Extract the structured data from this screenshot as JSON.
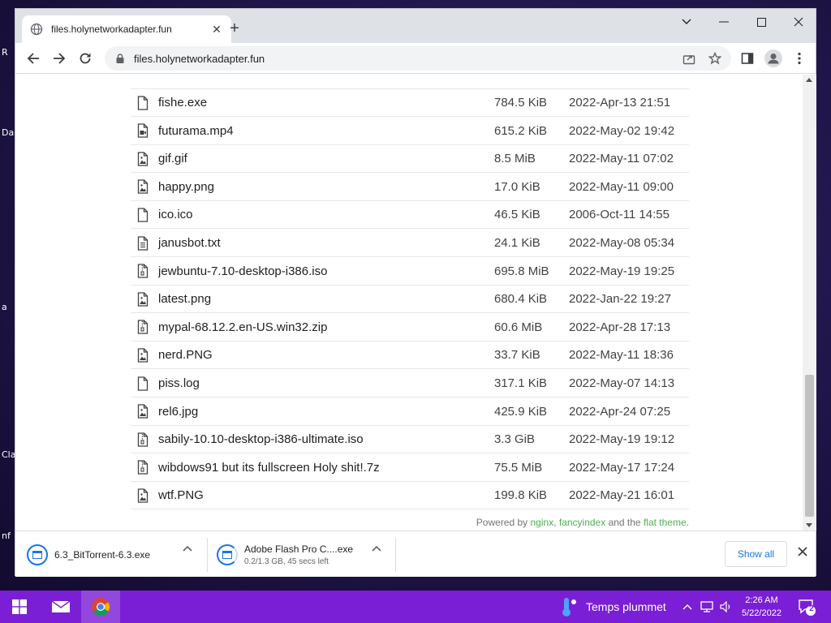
{
  "browser": {
    "tab_title": "files.holynetworkadapter.fun",
    "url": "files.holynetworkadapter.fun"
  },
  "files": [
    {
      "name": "fishe.exe",
      "size": "784.5 KiB",
      "date": "2022-Apr-13 21:51",
      "icon": "file-icon"
    },
    {
      "name": "futurama.mp4",
      "size": "615.2 KiB",
      "date": "2022-May-02 19:42",
      "icon": "video-file-icon"
    },
    {
      "name": "gif.gif",
      "size": "8.5 MiB",
      "date": "2022-May-11 07:02",
      "icon": "image-file-icon"
    },
    {
      "name": "happy.png",
      "size": "17.0 KiB",
      "date": "2022-May-11 09:00",
      "icon": "image-file-icon"
    },
    {
      "name": "ico.ico",
      "size": "46.5 KiB",
      "date": "2006-Oct-11 14:55",
      "icon": "file-icon"
    },
    {
      "name": "janusbot.txt",
      "size": "24.1 KiB",
      "date": "2022-May-08 05:34",
      "icon": "text-file-icon"
    },
    {
      "name": "jewbuntu-7.10-desktop-i386.iso",
      "size": "695.8 MiB",
      "date": "2022-May-19 19:25",
      "icon": "archive-file-icon"
    },
    {
      "name": "latest.png",
      "size": "680.4 KiB",
      "date": "2022-Jan-22 19:27",
      "icon": "image-file-icon"
    },
    {
      "name": "mypal-68.12.2.en-US.win32.zip",
      "size": "60.6 MiB",
      "date": "2022-Apr-28 17:13",
      "icon": "archive-file-icon"
    },
    {
      "name": "nerd.PNG",
      "size": "33.7 KiB",
      "date": "2022-May-11 18:36",
      "icon": "image-file-icon"
    },
    {
      "name": "piss.log",
      "size": "317.1 KiB",
      "date": "2022-May-07 14:13",
      "icon": "file-icon"
    },
    {
      "name": "rel6.jpg",
      "size": "425.9 KiB",
      "date": "2022-Apr-24 07:25",
      "icon": "image-file-icon"
    },
    {
      "name": "sabily-10.10-desktop-i386-ultimate.iso",
      "size": "3.3 GiB",
      "date": "2022-May-19 19:12",
      "icon": "archive-file-icon"
    },
    {
      "name": "wibdows91 but its fullscreen Holy shit!.7z",
      "size": "75.5 MiB",
      "date": "2022-May-17 17:24",
      "icon": "archive-file-icon"
    },
    {
      "name": "wtf.PNG",
      "size": "199.8 KiB",
      "date": "2022-May-21 16:01",
      "icon": "image-file-icon"
    }
  ],
  "footer": {
    "prefix": "Powered by ",
    "nginx": "nginx",
    "comma": ", ",
    "fancyindex": "fancyindex",
    "and_the": " and the ",
    "flat_theme": "flat theme",
    "suffix": "."
  },
  "downloads": [
    {
      "name": "6.3_BitTorrent-6.3.exe",
      "status": ""
    },
    {
      "name": "Adobe Flash Pro C....exe",
      "status": "0.2/1.3 GB, 45 secs left"
    }
  ],
  "shelf": {
    "show_all": "Show all"
  },
  "taskbar": {
    "weather": "Temps plummet",
    "time": "2:26 AM",
    "date": "5/22/2022",
    "notification_count": "2"
  },
  "desktop_labels": [
    "R",
    "Da",
    "a",
    "Cla",
    "nf"
  ],
  "colors": {
    "accent": "#1a73e8",
    "link_green": "#4caf50",
    "taskbar": "#7a1fd6"
  }
}
